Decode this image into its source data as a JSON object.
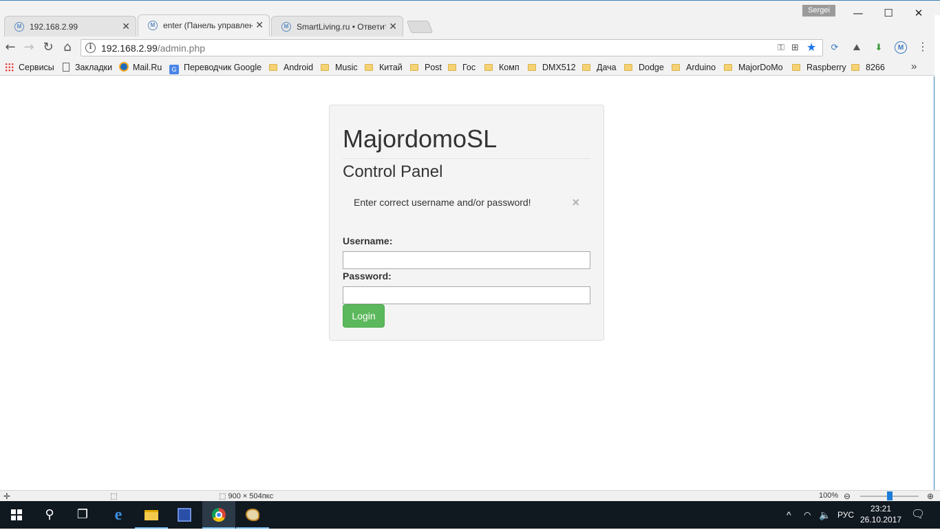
{
  "window": {
    "user_badge": "Sergei",
    "minimize": "—",
    "maximize": "☐",
    "close": "✕"
  },
  "tabs": [
    {
      "title": "192.168.2.99",
      "close": "✕",
      "favicon": "M"
    },
    {
      "title": "enter (Панель управлен",
      "close": "✕",
      "favicon": "M"
    },
    {
      "title": "SmartLiving.ru • Ответит",
      "close": "✕",
      "favicon": "M"
    }
  ],
  "toolbar": {
    "back": "←",
    "forward": "→",
    "reload": "↻",
    "home": "⌂",
    "url_host": "192.168.2.99",
    "url_path": "/admin.php",
    "menu": "⋮"
  },
  "bookmarks": [
    {
      "label": "Сервисы",
      "icon": "apps-grid-icon"
    },
    {
      "label": "Закладки",
      "icon": "page-icon"
    },
    {
      "label": "Mail.Ru",
      "icon": "mailru-icon"
    },
    {
      "label": "Переводчик Google",
      "icon": "google-translate-icon"
    },
    {
      "label": "Android",
      "icon": "folder-icon"
    },
    {
      "label": "Music",
      "icon": "folder-icon"
    },
    {
      "label": "Китай",
      "icon": "folder-icon"
    },
    {
      "label": "Post",
      "icon": "folder-icon"
    },
    {
      "label": "Гос",
      "icon": "folder-icon"
    },
    {
      "label": "Комп",
      "icon": "folder-icon"
    },
    {
      "label": "DMX512",
      "icon": "folder-icon"
    },
    {
      "label": "Дача",
      "icon": "folder-icon"
    },
    {
      "label": "Dodge",
      "icon": "folder-icon"
    },
    {
      "label": "Arduino",
      "icon": "folder-icon"
    },
    {
      "label": "MajorDoMo",
      "icon": "folder-icon"
    },
    {
      "label": "Raspberry",
      "icon": "folder-icon"
    },
    {
      "label": "8266",
      "icon": "folder-icon"
    }
  ],
  "bookmarks_more": "»",
  "login": {
    "brand": "MajordomoSL",
    "subtitle": "Control Panel",
    "alert_message": "Enter correct username and/or password!",
    "alert_close": "×",
    "username_label": "Username:",
    "username_value": "",
    "password_label": "Password:",
    "password_value": "",
    "submit_label": "Login"
  },
  "status_strip": {
    "dimensions": "900 × 504пкс",
    "zoom": "100%"
  },
  "taskbar": {
    "language": "РУС",
    "time": "23:21",
    "date": "26.10.2017"
  },
  "colors": {
    "login_button": "#5cb85c",
    "taskbar": "#101820",
    "chrome_frame": "#f2f2f2"
  }
}
